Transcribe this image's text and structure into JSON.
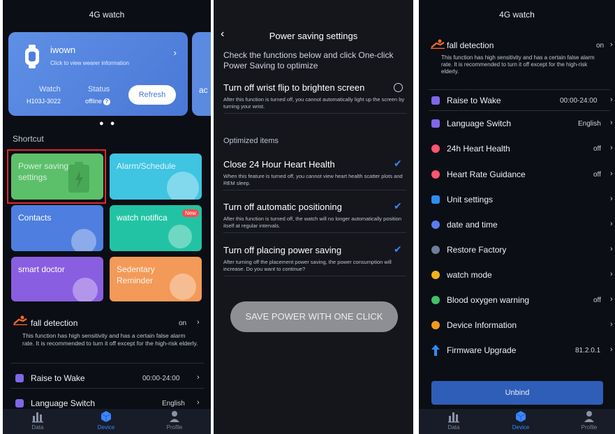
{
  "screen1": {
    "title": "4G watch",
    "device_card": {
      "name": "iwown",
      "subtitle": "Click to view wearer information",
      "watch_label": "Watch",
      "watch_value": "H103J-3022",
      "status_label": "Status",
      "status_value": "offline",
      "help_glyph": "?",
      "refresh_label": "Refresh",
      "next_card_peek": "ac"
    },
    "page_dots": "● ●",
    "shortcut_label": "Shortcut",
    "tiles": [
      {
        "label": "Power saving settings",
        "color": "#5cc06a"
      },
      {
        "label": "Alarm/Schedule",
        "color": "#3fc4e2"
      },
      {
        "label": "Contacts",
        "color": "#4e7fe0"
      },
      {
        "label": "watch notifica",
        "color": "#22c3a4",
        "badge": "New"
      },
      {
        "label": "smart doctor",
        "color": "#8a5ee0"
      },
      {
        "label": "Sedentary Reminder",
        "color": "#f39a58"
      }
    ],
    "fall_detection": {
      "title": "fall detection",
      "value": "on",
      "desc": "This function has high sensitivity and has a certain false alarm rate. It is recommended to turn it off except for the high-risk elderly."
    },
    "raise_to_wake": {
      "title": "Raise to Wake",
      "value": "00:00-24:00"
    },
    "language_switch": {
      "title": "Language Switch",
      "value": "English"
    },
    "tabs": [
      "Data",
      "Device",
      "Profile"
    ]
  },
  "screen2": {
    "title": "Power saving settings",
    "intro": "Check the functions below and click One-click Power Saving to optimize",
    "wrist_flip": {
      "title": "Turn off wrist flip to brighten screen",
      "desc": "After this function is turned off, you cannot automatically light up the screen by turning your wrist."
    },
    "section_label": "Optimized items",
    "items": [
      {
        "title": "Close 24 Hour Heart Health",
        "desc": "When this feature is turned off, you cannot view heart health scatter plots and REM sleep."
      },
      {
        "title": "Turn off automatic positioning",
        "desc": "After this function is turned off, the watch will no longer automatically position itself at regular intervals."
      },
      {
        "title": "Turn off placing power saving",
        "desc": "After turning off the placement power saving, the power consumption will increase. Do you want to continue?"
      }
    ],
    "save_button": "SAVE POWER WITH ONE CLICK"
  },
  "screen3": {
    "title": "4G watch",
    "fall_detection": {
      "title": "fall detection",
      "value": "on",
      "desc": "This function has high sensitivity and has a certain false alarm rate. It is recommended to turn it off except for the high-risk elderly."
    },
    "rows": [
      {
        "title": "Raise to Wake",
        "value": "00:00-24:00"
      },
      {
        "title": "Language Switch",
        "value": "English"
      },
      {
        "title": "24h Heart Health",
        "value": "off"
      },
      {
        "title": "Heart Rate Guidance",
        "value": "off"
      },
      {
        "title": "Unit settings",
        "value": ""
      },
      {
        "title": "date and time",
        "value": ""
      },
      {
        "title": "Restore Factory",
        "value": ""
      },
      {
        "title": "watch mode",
        "value": ""
      },
      {
        "title": "Blood oxygen warning",
        "value": "off"
      },
      {
        "title": "Device Information",
        "value": ""
      },
      {
        "title": "Firmware Upgrade",
        "value": "81.2.0.1"
      }
    ],
    "unbind_label": "Unbind",
    "tabs": [
      "Data",
      "Device",
      "Profile"
    ]
  },
  "colors": {
    "background": "#0b0e14",
    "accent": "#3b86ff",
    "card": "#4f7fdc",
    "highlight_frame": "#e02828"
  }
}
